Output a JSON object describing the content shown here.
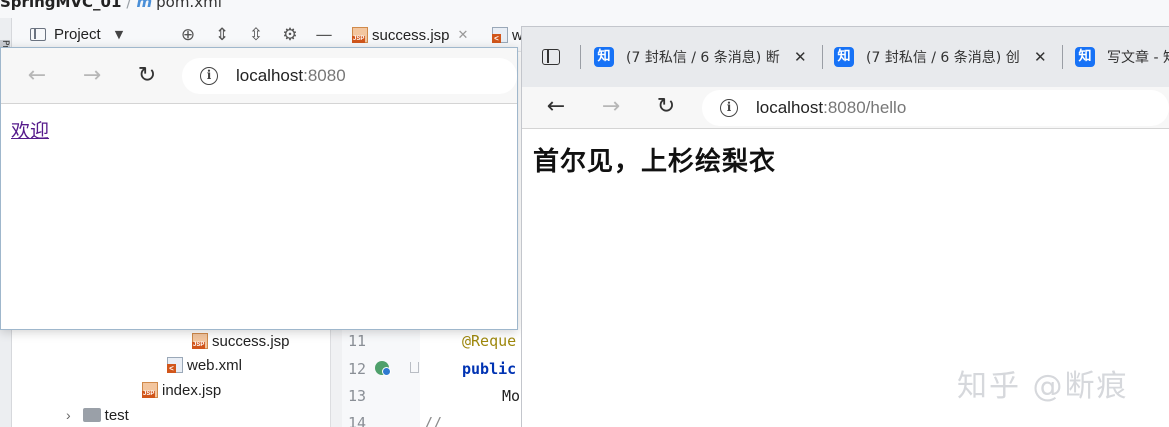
{
  "ide": {
    "project_name": "SpringMVC_01",
    "open_file": "pom.xml",
    "side_tab_label": "Proj",
    "project_panel_label": "Project",
    "tree_items": [
      {
        "label": "success.jsp",
        "type": "jsp"
      },
      {
        "label": "web.xml",
        "type": "xml"
      },
      {
        "label": "index.jsp",
        "type": "jsp"
      },
      {
        "label": "test",
        "type": "folder"
      }
    ],
    "editor_tabs": [
      {
        "label": "success.jsp"
      },
      {
        "label": "w"
      }
    ],
    "line_numbers": [
      "11",
      "12",
      "13",
      "14"
    ],
    "code_lines": [
      {
        "text": "@Reque",
        "kind": "annotation"
      },
      {
        "text": "public",
        "kind": "keyword"
      },
      {
        "text": "Mo",
        "kind": "text"
      },
      {
        "text": "//",
        "kind": "comment"
      }
    ]
  },
  "browser_left": {
    "address_host": "localhost",
    "address_rest": ":8080",
    "link_text": "欢迎"
  },
  "browser_right": {
    "tabs": [
      {
        "title": "(7 封私信 / 6 条消息) 断",
        "favicon": "知"
      },
      {
        "title": "(7 封私信 / 6 条消息) 创",
        "favicon": "知"
      },
      {
        "title": "写文章 - 知",
        "favicon": "知"
      }
    ],
    "address_host": "localhost",
    "address_rest": ":8080/hello",
    "heading": "首尔见，上杉绘梨衣"
  },
  "watermark": "知乎 @断痕"
}
